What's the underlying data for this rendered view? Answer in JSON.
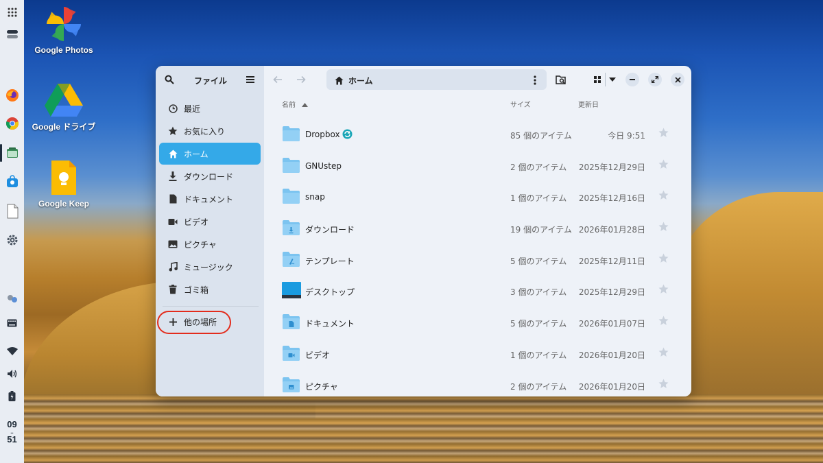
{
  "dock": {
    "clock_hour": "09",
    "clock_sep": "..",
    "clock_min": "51"
  },
  "desktop": {
    "icons": [
      {
        "label": "Google Photos"
      },
      {
        "label": "Google ドライブ"
      },
      {
        "label": "Google Keep"
      }
    ]
  },
  "window": {
    "sidebar": {
      "title": "ファイル",
      "items": [
        {
          "label": "最近",
          "icon": "clock-icon"
        },
        {
          "label": "お気に入り",
          "icon": "star-icon"
        },
        {
          "label": "ホーム",
          "icon": "home-icon",
          "active": true
        },
        {
          "label": "ダウンロード",
          "icon": "download-icon"
        },
        {
          "label": "ドキュメント",
          "icon": "document-icon"
        },
        {
          "label": "ビデオ",
          "icon": "video-icon"
        },
        {
          "label": "ピクチャ",
          "icon": "picture-icon"
        },
        {
          "label": "ミュージック",
          "icon": "music-icon"
        },
        {
          "label": "ゴミ箱",
          "icon": "trash-icon"
        }
      ],
      "other_places": "他の場所"
    },
    "path": "ホーム",
    "columns": {
      "name": "名前",
      "size": "サイズ",
      "modified": "更新日"
    },
    "files": [
      {
        "name": "Dropbox",
        "size": "85 個のアイテム",
        "date": "今日 9:51",
        "kind": "dropbox"
      },
      {
        "name": "GNUstep",
        "size": "2 個のアイテム",
        "date": "2025年12月29日",
        "kind": "plain"
      },
      {
        "name": "snap",
        "size": "1 個のアイテム",
        "date": "2025年12月16日",
        "kind": "plain"
      },
      {
        "name": "ダウンロード",
        "size": "19 個のアイテム",
        "date": "2026年01月28日",
        "kind": "download"
      },
      {
        "name": "テンプレート",
        "size": "5 個のアイテム",
        "date": "2025年12月11日",
        "kind": "template"
      },
      {
        "name": "デスクトップ",
        "size": "3 個のアイテム",
        "date": "2025年12月29日",
        "kind": "desktop"
      },
      {
        "name": "ドキュメント",
        "size": "5 個のアイテム",
        "date": "2026年01月07日",
        "kind": "document"
      },
      {
        "name": "ビデオ",
        "size": "1 個のアイテム",
        "date": "2026年01月20日",
        "kind": "video"
      },
      {
        "name": "ピクチャ",
        "size": "2 個のアイテム",
        "date": "2026年01月20日",
        "kind": "picture"
      }
    ]
  },
  "colors": {
    "accent": "#34a9e8",
    "folder": "#7cc4f0",
    "highlight_ring": "#e32c1d"
  }
}
